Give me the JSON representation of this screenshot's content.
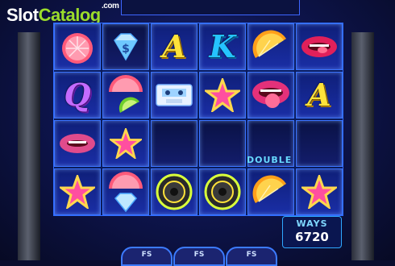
{
  "watermark": {
    "part1": "Slot",
    "part2": "Catalog",
    "suffix": ".com"
  },
  "reels": [
    [
      "grapefruit",
      "lime",
      "crown-q",
      "purple-lips",
      "star",
      "grapefruit",
      "bare-lips"
    ],
    [],
    [],
    [],
    [],
    []
  ],
  "grid": {
    "row1": [
      "grapefruit",
      "diamond",
      "letter-A",
      "letter-K",
      "orange",
      "lips-tongue"
    ],
    "row2": [
      "letter-Q",
      "grapefruit-lime",
      "cassette",
      "star",
      "lips-big-tongue",
      "letter-A-yellow"
    ],
    "row3": [
      "lips-pink",
      "star",
      "",
      "",
      "",
      ""
    ],
    "row4": [
      "star",
      "grapefruit-diamond",
      "speaker",
      "speaker",
      "orange-slice",
      "star"
    ]
  },
  "symbols": {
    "letter_a": "A",
    "letter_k": "K",
    "letter_q": "Q",
    "letter_a2": "A"
  },
  "double_label": "DOUBLE",
  "ways": {
    "label": "WAYS",
    "value": "6720"
  },
  "fs_buttons": [
    "FS",
    "FS",
    "FS"
  ]
}
